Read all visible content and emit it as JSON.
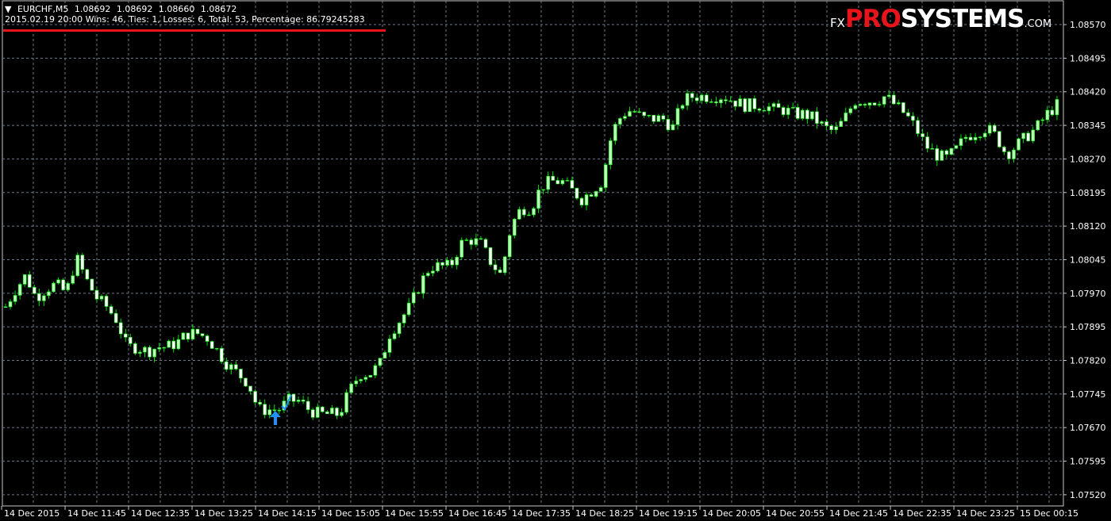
{
  "header": {
    "symbol_line": [
      "EURCHF,M5",
      "1.08692",
      "1.08692",
      "1.08660",
      "1.08672"
    ],
    "stats_line": "2015.02.19 20:00 Wins: 46, Ties: 1, Losses: 6, Total: 53, Percentage: 86.79245283"
  },
  "logo": {
    "fx": "FX",
    "pro": "PRO",
    "systems": "SYSTEMS",
    "com": ".COM"
  },
  "colors": {
    "bull": "#b8ffb8",
    "bear": "#ffffff",
    "wick": "#00e000",
    "grid": "#6b7a8a",
    "arrow": "#1e90ff",
    "accent": "#e8141c"
  },
  "chart_data": {
    "type": "candlestick",
    "symbol": "EURCHF",
    "timeframe": "M5",
    "y_ticks": [
      "1.08570",
      "1.08495",
      "1.08420",
      "1.08345",
      "1.08270",
      "1.08195",
      "1.08120",
      "1.08045",
      "1.07970",
      "1.07895",
      "1.07820",
      "1.07745",
      "1.07670",
      "1.07595",
      "1.07520"
    ],
    "ylim": [
      1.07495,
      1.08625
    ],
    "x_ticks": [
      "14 Dec 2015",
      "14 Dec 11:45",
      "14 Dec 12:35",
      "14 Dec 13:25",
      "14 Dec 14:15",
      "14 Dec 15:05",
      "14 Dec 15:55",
      "14 Dec 16:45",
      "14 Dec 17:35",
      "14 Dec 18:25",
      "14 Dec 19:15",
      "14 Dec 20:05",
      "14 Dec 20:55",
      "14 Dec 21:45",
      "14 Dec 22:35",
      "14 Dec 23:25",
      "15 Dec 00:15"
    ],
    "close_path": [
      1.0794,
      1.0798,
      1.0801,
      1.0796,
      1.0798,
      1.0799,
      1.0797,
      1.0805,
      1.08,
      1.0796,
      1.0794,
      1.0791,
      1.0785,
      1.0785,
      1.0784,
      1.0785,
      1.0785,
      1.0786,
      1.0788,
      1.0788,
      1.0787,
      1.0784,
      1.0781,
      1.0779,
      1.0777,
      1.0771,
      1.0771,
      1.0771,
      1.0773,
      1.0773,
      1.0771,
      1.077,
      1.077,
      1.077,
      1.0775,
      1.0779,
      1.0779,
      1.0781,
      1.0788,
      1.0791,
      1.0794,
      1.0799,
      1.0803,
      1.0803,
      1.0803,
      1.0808,
      1.0809,
      1.0808,
      1.0804,
      1.0801,
      1.0812,
      1.0816,
      1.0816,
      1.0821,
      1.0822,
      1.0822,
      1.082,
      1.0818,
      1.082,
      1.0822,
      1.0833,
      1.0837,
      1.0838,
      1.0836,
      1.0836,
      1.0836,
      1.0834,
      1.084,
      1.0841,
      1.0841,
      1.0841,
      1.0841,
      1.084,
      1.0839,
      1.0839,
      1.0839,
      1.0838,
      1.0838,
      1.0837,
      1.0837,
      1.0836,
      1.0834,
      1.0833,
      1.0836,
      1.084,
      1.084,
      1.084,
      1.0841,
      1.0839,
      1.0837,
      1.0834,
      1.083,
      1.0828,
      1.0827,
      1.0829,
      1.0832,
      1.0833,
      1.0834,
      1.0832,
      1.0828,
      1.083,
      1.0832,
      1.0834,
      1.0837,
      1.0839
    ],
    "signals": [
      {
        "type": "buy-arrow",
        "bar_index": 42
      },
      {
        "type": "check",
        "bar_index": 44
      }
    ]
  }
}
